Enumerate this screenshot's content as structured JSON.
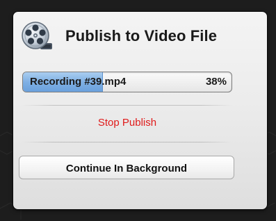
{
  "dialog": {
    "title": "Publish to Video File",
    "icon": "film-reel-icon",
    "progress": {
      "file_name": "Recording #39.mp4",
      "percent_label": "38%",
      "fraction": 0.38
    },
    "stop_label": "Stop Publish",
    "continue_label": "Continue In Background"
  },
  "colors": {
    "accent_fill": "#7fb0e4",
    "stop_text": "#e01a1a",
    "backdrop": "#1d1d1d"
  }
}
